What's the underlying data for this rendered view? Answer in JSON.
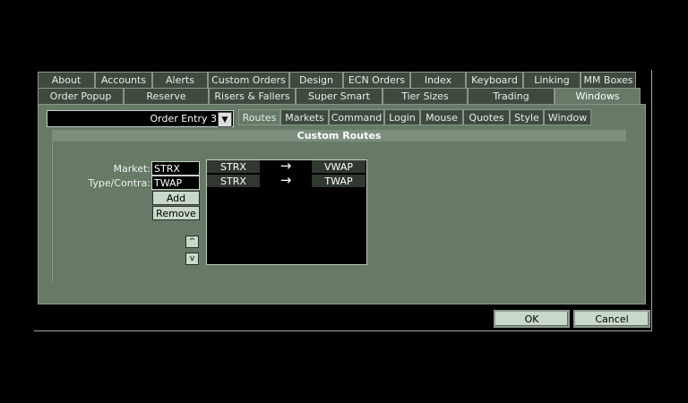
{
  "tabs_row1": [
    "About",
    "Accounts",
    "Alerts",
    "Custom Orders",
    "Design",
    "ECN Orders",
    "Index",
    "Keyboard",
    "Linking",
    "MM Boxes"
  ],
  "tabs_row2": [
    "Order Popup",
    "Reserve",
    "Risers & Fallers",
    "Super Smart",
    "Tier Sizes",
    "Trading",
    "Windows"
  ],
  "active_tab": "Windows",
  "window_select": {
    "value": "Order Entry 3",
    "arrow_icon": "chevron-down-icon"
  },
  "subtabs": [
    "Routes",
    "Markets",
    "Command",
    "Login",
    "Mouse",
    "Quotes",
    "Style",
    "Window"
  ],
  "active_subtab": "Routes",
  "custom_routes": {
    "title": "Custom Routes",
    "market_label": "Market:",
    "market_value": "STRX",
    "type_label": "Type/Contra:",
    "type_value": "TWAP",
    "add_label": "Add",
    "remove_label": "Remove",
    "up_label": "^",
    "down_label": "v",
    "routes": [
      {
        "from": "STRX",
        "arrow": "→",
        "to": "VWAP"
      },
      {
        "from": "STRX",
        "arrow": "→",
        "to": "TWAP"
      }
    ]
  },
  "footer": {
    "ok_label": "OK",
    "cancel_label": "Cancel"
  },
  "colors": {
    "panel": "#667a66",
    "tab": "#3f4a3f",
    "button": "#c9d9c9"
  }
}
